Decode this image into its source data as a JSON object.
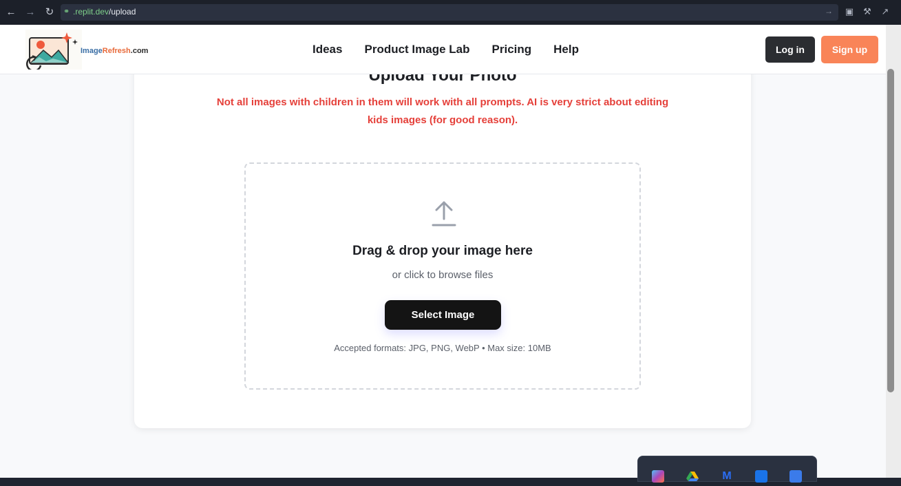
{
  "browser": {
    "url_host": ".replit.dev",
    "url_path": "/upload"
  },
  "header": {
    "logo": {
      "text_a": "Image",
      "text_b": "Refresh",
      "text_c": ".com"
    },
    "nav": [
      "Ideas",
      "Product Image Lab",
      "Pricing",
      "Help"
    ],
    "login_label": "Log in",
    "signup_label": "Sign up"
  },
  "upload": {
    "title": "Upload Your Photo",
    "warning": "Not all images with children in them will work with all prompts. AI is very strict about editing kids images (for good reason).",
    "dropzone_title": "Drag & drop your image here",
    "dropzone_sub": "or click to browse files",
    "select_label": "Select Image",
    "formats": "Accepted formats: JPG, PNG, WebP • Max size: 10MB"
  },
  "colors": {
    "accent": "#f98458",
    "warning": "#e5403a",
    "dark_button": "#141414"
  },
  "tray_icons": [
    "copilot-icon",
    "google-drive-icon",
    "malwarebytes-icon",
    "outlook-icon",
    "apps-icon"
  ]
}
